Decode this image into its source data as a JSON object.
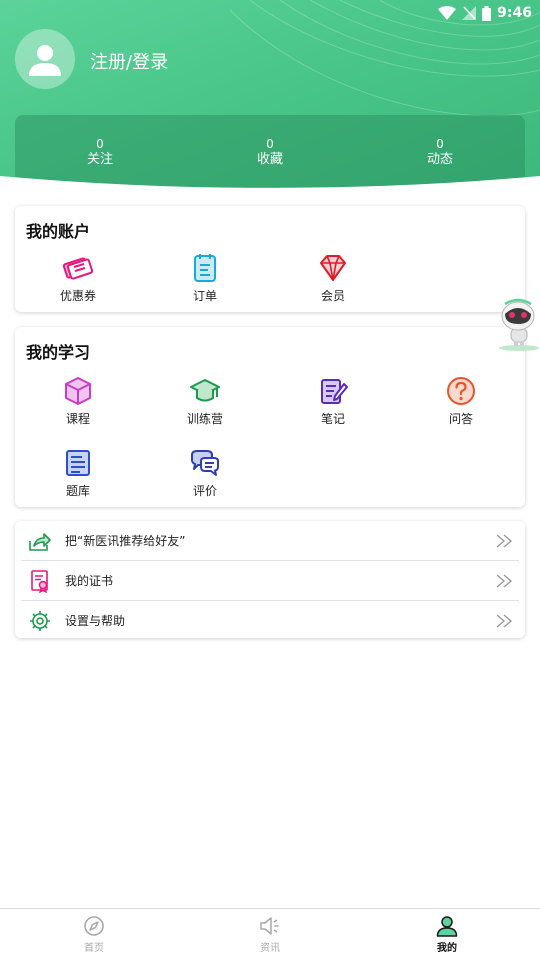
{
  "status_bar": {
    "time": "9:46"
  },
  "profile": {
    "login_label": "注册/登录"
  },
  "stats": [
    {
      "count": "0",
      "label": "关注"
    },
    {
      "count": "0",
      "label": "收藏"
    },
    {
      "count": "0",
      "label": "动态"
    }
  ],
  "account": {
    "title": "我的账户",
    "items": [
      {
        "label": "优惠券",
        "icon": "coupon-icon"
      },
      {
        "label": "订单",
        "icon": "order-icon"
      },
      {
        "label": "会员",
        "icon": "diamond-icon"
      }
    ]
  },
  "study": {
    "title": "我的学习",
    "items": [
      {
        "label": "课程",
        "icon": "cube-icon"
      },
      {
        "label": "训练营",
        "icon": "graduation-cap-icon"
      },
      {
        "label": "笔记",
        "icon": "note-icon"
      },
      {
        "label": "问答",
        "icon": "question-icon"
      },
      {
        "label": "题库",
        "icon": "document-icon"
      },
      {
        "label": "评价",
        "icon": "chat-bubbles-icon"
      }
    ]
  },
  "menu": [
    {
      "label": "把“新医讯推荐给好友”",
      "icon": "share-icon"
    },
    {
      "label": "我的证书",
      "icon": "certificate-icon"
    },
    {
      "label": "设置与帮助",
      "icon": "gear-icon"
    }
  ],
  "bottom_nav": [
    {
      "label": "首页",
      "icon": "compass-icon",
      "active": false
    },
    {
      "label": "资讯",
      "icon": "speaker-icon",
      "active": false
    },
    {
      "label": "我的",
      "icon": "user-icon",
      "active": true
    }
  ],
  "colors": {
    "header_green": "#46c386",
    "coupon": "#e8177d",
    "order": "#1aa9d8",
    "diamond": "#e01c2a",
    "course": "#c93cc9",
    "camp": "#1e9a4e",
    "note": "#5b2bb5",
    "question": "#e8542a",
    "bank": "#2f4fc9",
    "review": "#2f3fb0"
  }
}
